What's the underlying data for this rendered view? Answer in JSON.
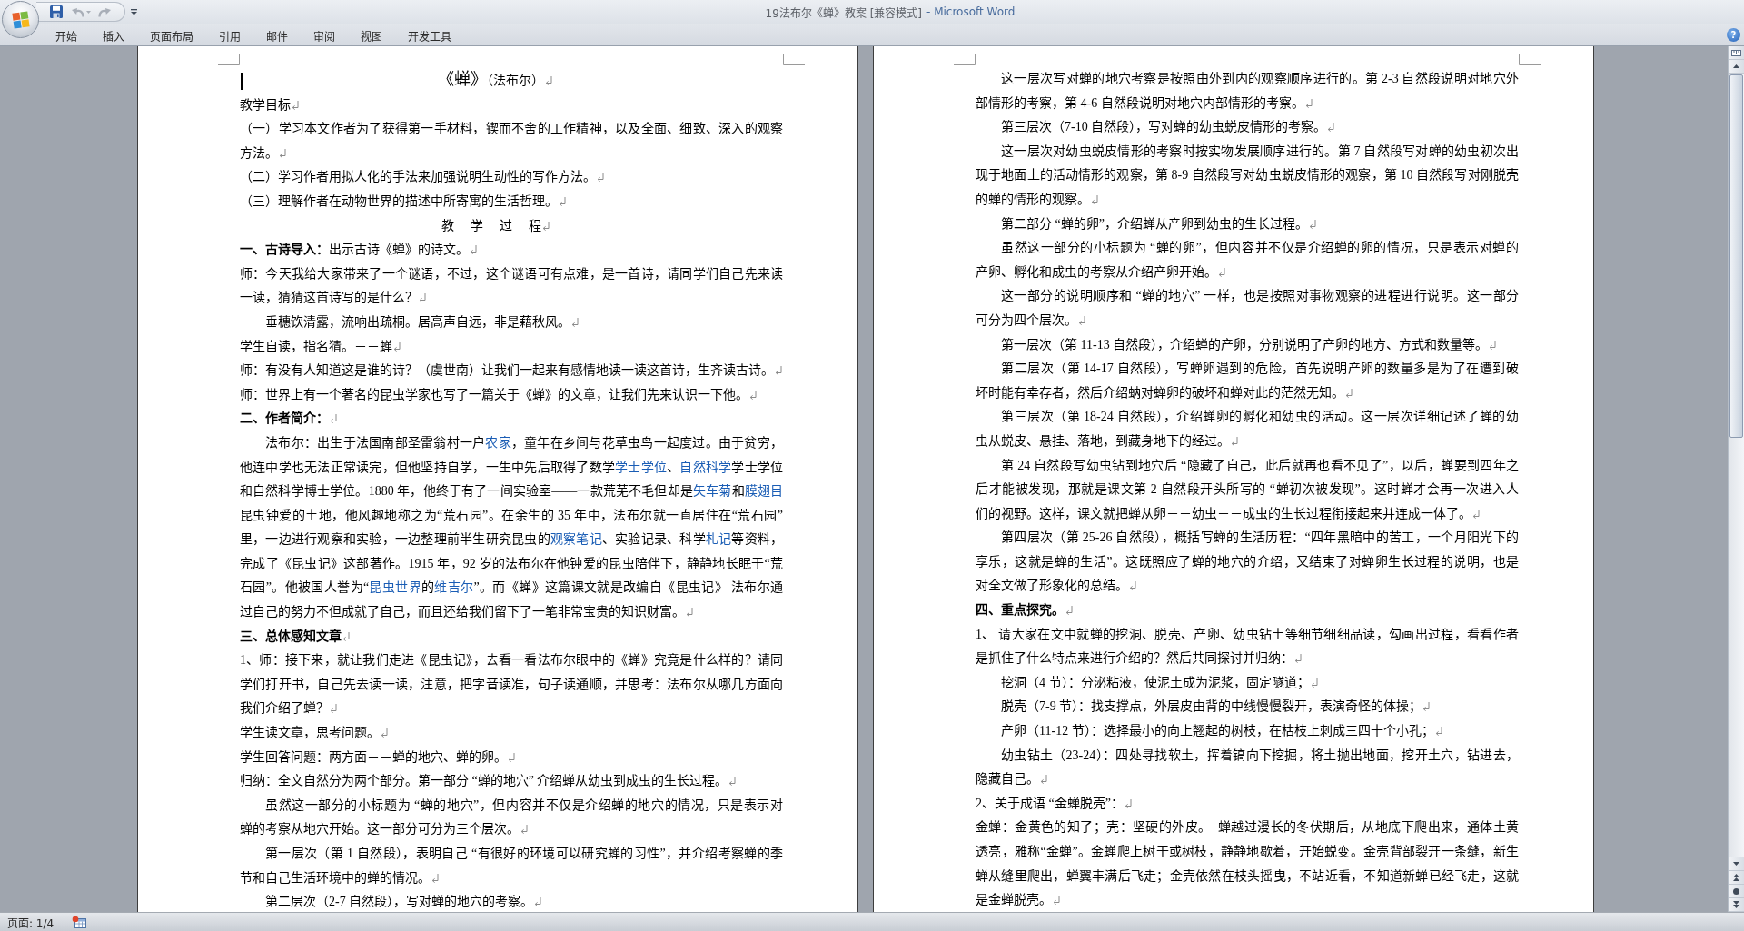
{
  "window": {
    "title": "19法布尔《蝉》教案 [兼容模式]",
    "app_name": "- Microsoft Word"
  },
  "quick_access": [
    {
      "kind": "save",
      "disabled": false
    },
    {
      "kind": "undo",
      "disabled": true
    },
    {
      "kind": "redo",
      "disabled": true
    },
    {
      "kind": "customize",
      "disabled": false
    }
  ],
  "ribbon_tabs": [
    {
      "label": "开始",
      "selected": false
    },
    {
      "label": "插入",
      "selected": false
    },
    {
      "label": "页面布局",
      "selected": false
    },
    {
      "label": "引用",
      "selected": false
    },
    {
      "label": "邮件",
      "selected": false
    },
    {
      "label": "审阅",
      "selected": false
    },
    {
      "label": "视图",
      "selected": false
    },
    {
      "label": "开发工具",
      "selected": false
    }
  ],
  "help_button": {
    "label": "?"
  },
  "document": {
    "formatting_marks": true,
    "pages": [
      {
        "cursor": true,
        "paragraphs": [
          {
            "kind": "title",
            "lines": [
              [
                {
                  "kind": "large",
                  "text": "《蝉》"
                },
                "（法布尔）"
              ]
            ]
          },
          {
            "kind": "plain",
            "lines": [
              "教学目标"
            ]
          },
          {
            "kind": "plain",
            "lines": [
              "（一）学习本文作者为了获得第一手材料，锲而不舍的工作精神，以及全面、细致、深入的观察",
              "方法。"
            ]
          },
          {
            "kind": "plain",
            "lines": [
              "（二）学习作者用拟人化的手法来加强说明生动性的写作方法。"
            ]
          },
          {
            "kind": "plain",
            "lines": [
              "（三）理解作者在动物世界的描述中所寄寓的生活哲理。"
            ]
          },
          {
            "kind": "spaced",
            "lines": [
              "教 学 过 程"
            ]
          },
          {
            "kind": "plain",
            "lines": [
              "**一、古诗导入：**出示古诗《蝉》的诗文。"
            ]
          },
          {
            "kind": "plain",
            "lines": [
              "师：今天我给大家带来了一个谜语，不过，这个谜语可有点难，是一首诗，请同学们自己先来读",
              "一读，猜猜这首诗写的是什么？"
            ]
          },
          {
            "kind": "indented",
            "lines": [
              "垂穗饮清露，流响出疏桐。居高声自远，非是藉秋风。"
            ]
          },
          {
            "kind": "plain",
            "lines": [
              "学生自读，指名猜。－－蝉"
            ]
          },
          {
            "kind": "plain",
            "lines": [
              "师：有没有人知道这是谁的诗？（虞世南）让我们一起来有感情地读一读这首诗，生齐读古诗。"
            ]
          },
          {
            "kind": "plain",
            "lines": [
              "师：世界上有一个著名的昆虫学家也写了一篇关于《蝉》的文章，让我们先来认识一下他。"
            ]
          },
          {
            "kind": "heading",
            "lines": [
              "二、作者简介："
            ]
          },
          {
            "kind": "indented",
            "lines": [
              [
                "法布尔：出生于法国南部圣雷翁村一户",
                {
                  "kind": "link",
                  "text": "农家"
                },
                "，童年在乡间与花草虫鸟一起度过。由于贫穷，"
              ],
              [
                "他连中学也无法正常读完，但他坚持自学，一生中先后取得了数学",
                {
                  "kind": "link",
                  "text": "学士学位"
                },
                "、",
                {
                  "kind": "link",
                  "text": "自然科学"
                },
                "学士学位"
              ],
              [
                "和自然科学博士学位。1880 年，他终于有了一间实验室——一款荒芜不毛但却是",
                {
                  "kind": "link",
                  "text": "矢车菊"
                },
                "和",
                {
                  "kind": "link",
                  "text": "膜翅目"
                }
              ],
              "昆虫钟爱的土地，他风趣地称之为“荒石园”。在余生的 35 年中，法布尔就一直居住在“荒石园”",
              [
                "里，一边进行观察和实验，一边整理前半生研究昆虫的",
                {
                  "kind": "link",
                  "text": "观察笔记"
                },
                "、实验记录、科学",
                {
                  "kind": "link",
                  "text": "札记"
                },
                "等资料，"
              ],
              "完成了《昆虫记》这部著作。1915 年，92 岁的法布尔在他钟爱的昆虫陪伴下，静静地长眠于“荒",
              [
                "石园”。他被国人誉为“",
                {
                  "kind": "link",
                  "text": "昆虫世界"
                },
                "的",
                {
                  "kind": "link",
                  "text": "维吉尔"
                },
                "”。而《蝉》这篇课文就是改编自《昆虫记》 法布尔通"
              ],
              "过自己的努力不但成就了自己，而且还给我们留下了一笔非常宝贵的知识财富。"
            ]
          },
          {
            "kind": "heading",
            "lines": [
              "三、总体感知文章"
            ]
          },
          {
            "kind": "plain",
            "lines": [
              "1、师：接下来，就让我们走进《昆虫记》，去看一看法布尔眼中的《蝉》究竟是什么样的？请同",
              "学们打开书，自己先去读一读，注意，把字音读准，句子读通顺，并思考：法布尔从哪几方面向",
              "我们介绍了蝉？"
            ]
          },
          {
            "kind": "plain",
            "lines": [
              "学生读文章，思考问题。"
            ]
          },
          {
            "kind": "plain",
            "lines": [
              "学生回答问题：两方面－－蝉的地穴、蝉的卵。"
            ]
          },
          {
            "kind": "plain",
            "lines": [
              "归纳：全文自然分为两个部分。第一部分 “蝉的地穴” 介绍蝉从幼虫到成虫的生长过程。"
            ]
          },
          {
            "kind": "indented",
            "lines": [
              "虽然这一部分的小标题为 “蝉的地穴”，但内容并不仅是介绍蝉的地穴的情况，只是表示对",
              "蝉的考察从地穴开始。这一部分可分为三个层次。"
            ]
          },
          {
            "kind": "indented",
            "lines": [
              "第一层次（第 1 自然段），表明自己 “有很好的环境可以研究蝉的习性”，并介绍考察蝉的季",
              "节和自己生活环境中的蝉的情况。"
            ]
          },
          {
            "kind": "indented",
            "lines": [
              "第二层次（2-7 自然段），写对蝉的地穴的考察。"
            ]
          }
        ]
      },
      {
        "cursor": false,
        "paragraphs": [
          {
            "kind": "indented",
            "lines": [
              "这一层次写对蝉的地穴考察是按照由外到内的观察顺序进行的。第 2-3 自然段说明对地穴外",
              "部情形的考察，第 4-6 自然段说明对地穴内部情形的考察。"
            ]
          },
          {
            "kind": "indented",
            "lines": [
              "第三层次（7-10 自然段），写对蝉的幼虫蜕皮情形的考察。"
            ]
          },
          {
            "kind": "indented",
            "lines": [
              "这一层次对幼虫蜕皮情形的考察时按实物发展顺序进行的。第 7 自然段写对蝉的幼虫初次出",
              "现于地面上的活动情形的观察，第 8-9 自然段写对幼虫蜕皮情形的观察，第 10 自然段写对刚脱壳",
              "的蝉的情形的观察。"
            ]
          },
          {
            "kind": "indented",
            "lines": [
              "第二部分 “蝉的卵”，介绍蝉从产卵到幼虫的生长过程。"
            ]
          },
          {
            "kind": "indented",
            "lines": [
              "虽然这一部分的小标题为 “蝉的卵”，但内容并不仅是介绍蝉的卵的情况，只是表示对蝉的",
              "产卵、孵化和成虫的考察从介绍产卵开始。"
            ]
          },
          {
            "kind": "indented",
            "lines": [
              "这一部分的说明顺序和 “蝉的地穴” 一样，也是按照对事物观察的进程进行说明。这一部分",
              "可分为四个层次。"
            ]
          },
          {
            "kind": "indented",
            "lines": [
              "第一层次（第 11-13 自然段），介绍蝉的产卵，分别说明了产卵的地方、方式和数量等。"
            ]
          },
          {
            "kind": "indented",
            "lines": [
              "第二层次（第 14-17 自然段），写蝉卵遇到的危险，首先说明产卵的数量多是为了在遭到破",
              "坏时能有幸存者，然后介绍蚋对蝉卵的破坏和蝉对此的茫然无知。"
            ]
          },
          {
            "kind": "indented",
            "lines": [
              "第三层次（第 18-24 自然段），介绍蝉卵的孵化和幼虫的活动。这一层次详细记述了蝉的幼",
              "虫从蜕皮、悬挂、落地，到藏身地下的经过。"
            ]
          },
          {
            "kind": "indented",
            "lines": [
              "第 24 自然段写幼虫钻到地穴后 “隐藏了自己，此后就再也看不见了”，以后，蝉要到四年之",
              "后才能被发现，那就是课文第 2 自然段开头所写的 “蝉初次被发现”。这时蝉才会再一次进入人",
              "们的视野。这样，课文就把蝉从卵－－幼虫－－成虫的生长过程衔接起来并连成一体了。"
            ]
          },
          {
            "kind": "indented",
            "lines": [
              "第四层次（第 25-26 自然段），概括写蝉的生活历程：“四年黑暗中的苦工，一个月阳光下的",
              "享乐，这就是蝉的生活”。这既照应了蝉的地穴的介绍，又结束了对蝉卵生长过程的说明，也是",
              "对全文做了形象化的总结。"
            ]
          },
          {
            "kind": "heading",
            "lines": [
              "四、重点探究。"
            ]
          },
          {
            "kind": "plain",
            "lines": [
              "1、 请大家在文中就蝉的挖洞、脱壳、产卵、幼虫钻土等细节细细品读，勾画出过程，看看作者",
              "是抓住了什么特点来进行介绍的？然后共同探讨并归纳："
            ]
          },
          {
            "kind": "indented",
            "lines": [
              "挖洞（4 节）：分泌粘液，使泥土成为泥浆，固定隧道；"
            ]
          },
          {
            "kind": "indented",
            "lines": [
              "脱壳（7-9 节）：找支撑点，外层皮由背的中线慢慢裂开，表演奇怪的体操；"
            ]
          },
          {
            "kind": "indented",
            "lines": [
              "产卵（11-12 节）：选择最小的向上翘起的树枝，在枯枝上刺成三四十个小孔；"
            ]
          },
          {
            "kind": "indented",
            "lines": [
              "幼虫钻土（23-24）：四处寻找软土，挥着镐向下挖掘，将土抛出地面，挖开土穴，钻进去，",
              "隐藏自己。"
            ]
          },
          {
            "kind": "plain",
            "lines": [
              "2、关于成语 “金蝉脱壳”："
            ]
          },
          {
            "kind": "plain",
            "lines": [
              "金蝉：金黄色的知了；壳：坚硬的外皮。　蝉越过漫长的冬伏期后，从地底下爬出来，通体土黄",
              "透亮，雅称“金蝉”。金蝉爬上树干或树枝，静静地歇着，开始蜕变。金壳背部裂开一条缝，新生",
              "蝉从缝里爬出，蝉翼丰满后飞走；金壳依然在枝头摇曳，不站近看，不知道新蝉已经飞走，这就",
              "是金蝉脱壳。"
            ]
          }
        ]
      }
    ]
  },
  "status_bar": {
    "page_indicator": "页面: 1/4"
  }
}
